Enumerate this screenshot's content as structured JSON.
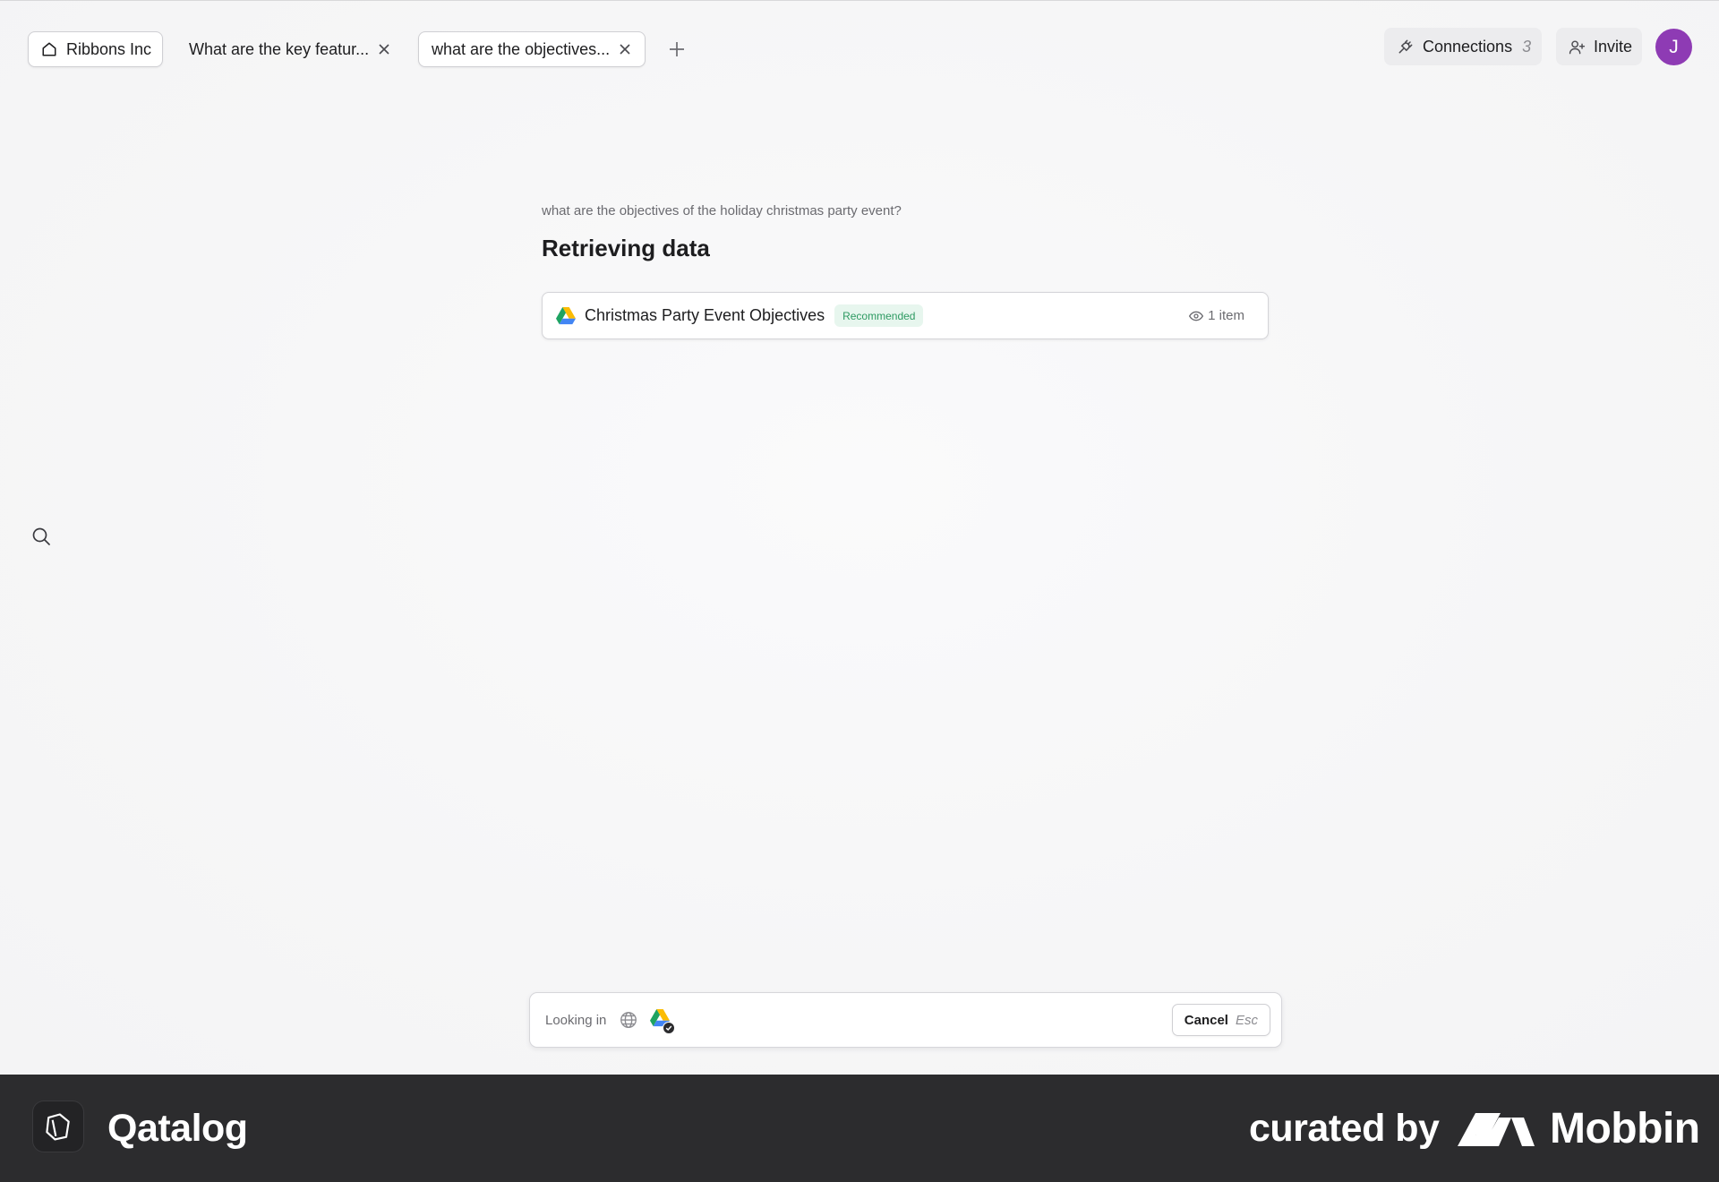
{
  "tabs": {
    "home_label": "Ribbons Inc",
    "tab1_label": "What are the key featur...",
    "tab2_label": "what are the objectives..."
  },
  "header": {
    "connections_label": "Connections",
    "connections_count": "3",
    "invite_label": "Invite",
    "avatar_initial": "J"
  },
  "main": {
    "query": "what are the objectives of the holiday christmas party event?",
    "status_heading": "Retrieving data",
    "result": {
      "title": "Christmas Party Event Objectives",
      "badge": "Recommended",
      "item_count": "1 item"
    }
  },
  "prompt": {
    "looking_in_label": "Looking in",
    "cancel_label": "Cancel",
    "cancel_key": "Esc"
  },
  "footer": {
    "brand": "Qatalog",
    "curated_by": "curated by",
    "mobbin": "Mobbin"
  },
  "icons": {
    "home": "home-icon",
    "close": "close-icon",
    "plus": "plus-icon",
    "plug": "plug-icon",
    "user_add": "user-add-icon",
    "search": "search-icon",
    "drive": "google-drive-icon",
    "eye": "eye-icon",
    "globe": "globe-icon"
  },
  "colors": {
    "avatar": "#8e3bb4",
    "badge_bg": "#e7f6ee",
    "badge_text": "#2e9a62",
    "footer_bg": "#2c2c2e"
  }
}
